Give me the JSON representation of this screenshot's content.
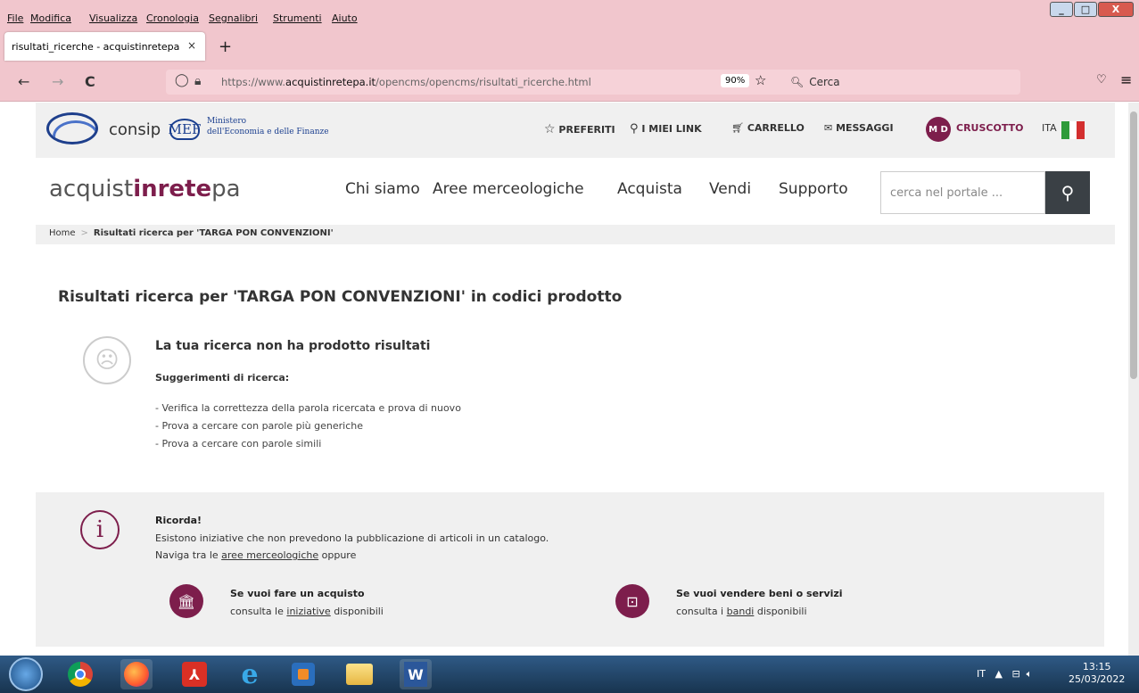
{
  "menubar": {
    "items": [
      "File",
      "Modifica",
      "Visualizza",
      "Cronologia",
      "Segnalibri",
      "Strumenti",
      "Aiuto"
    ]
  },
  "window": {
    "min": "_",
    "max": "□",
    "close": "X"
  },
  "tab": {
    "title": "risultati_ricerche - acquistinretepa",
    "close": "×",
    "new": "+"
  },
  "nav": {
    "back": "←",
    "forward": "→",
    "reload": "C",
    "url_pre": "https://www.",
    "url_host": "acquistinretepa.it",
    "url_path": "/opencms/opencms/risultati_ricerche.html",
    "zoom": "90%",
    "search_placeholder": "Cerca"
  },
  "header": {
    "consip": "consip",
    "mef": "MEF",
    "ministero_line1": "Ministero",
    "ministero_line2": "dell'Economia e delle Finanze",
    "preferiti": "PREFERITI",
    "imiei": "I MIEI LINK",
    "carrello": "CARRELLO",
    "messaggi": "MESSAGGI",
    "initials": "M D",
    "cruscotto": "CRUSCOTTO",
    "lang": "ITA"
  },
  "mainnav": {
    "brand_a": "acquist",
    "brand_b": "inrete",
    "brand_c": "pa",
    "items": [
      "Chi siamo",
      "Aree merceologiche",
      "Acquista",
      "Vendi",
      "Supporto"
    ],
    "search_placeholder": "cerca nel portale ..."
  },
  "breadcrumb": {
    "home": "Home",
    "current": "Risultati ricerca per 'TARGA PON CONVENZIONI'"
  },
  "results": {
    "title": "Risultati ricerca per 'TARGA PON CONVENZIONI' in codici prodotto",
    "no_result": "La tua ricerca non ha prodotto risultati",
    "sugg_title": "Suggerimenti di ricerca:",
    "sugg": [
      "- Verifica la correttezza della parola ricercata e prova di nuovo",
      "- Prova a cercare con parole più generiche",
      "- Prova a cercare con parole simili"
    ]
  },
  "ricorda": {
    "title": "Ricorda!",
    "text1": "Esistono iniziative che non prevedono la pubblicazione di articoli in un catalogo.",
    "text2_pre": "Naviga tra le ",
    "text2_link": "aree merceologiche",
    "text2_post": " oppure",
    "buy_title": "Se vuoi fare un acquisto",
    "buy_pre": "consulta le ",
    "buy_link": "iniziative",
    "buy_post": " disponibili",
    "sell_title": "Se vuoi vendere beni o servizi",
    "sell_pre": "consulta i ",
    "sell_link": "bandi",
    "sell_post": " disponibili"
  },
  "taskbar": {
    "lang": "IT",
    "time": "13:15",
    "date": "25/03/2022"
  },
  "colors": {
    "accent": "#7d1e4c",
    "chrome": "#f1c6cd"
  }
}
